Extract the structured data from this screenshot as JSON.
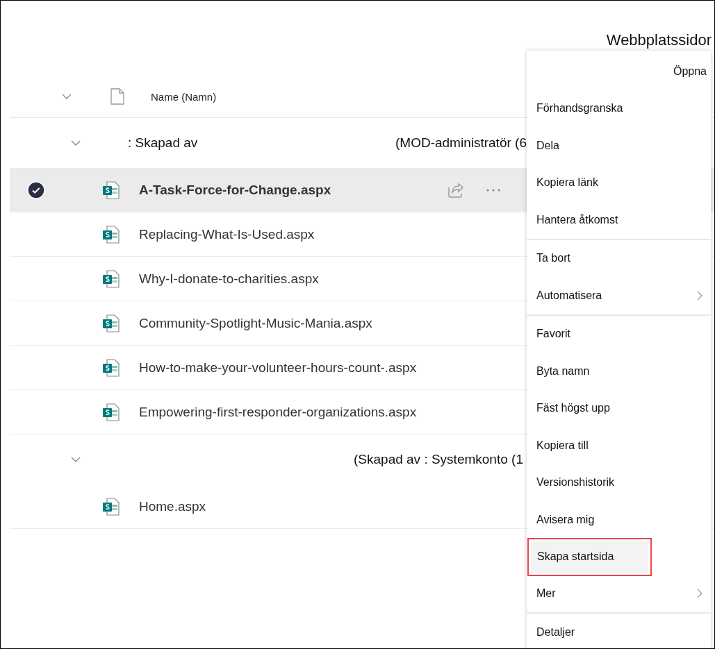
{
  "page_title": "Webbplatssidor",
  "list": {
    "column_header": "Name (Namn)",
    "groups": [
      {
        "title": ": Skapad av",
        "owner": "(MOD-administratör (6",
        "expanded": true,
        "files": [
          {
            "name": "A-Task-Force-for-Change.aspx",
            "selected": true
          },
          {
            "name": "Replacing-What-Is-Used.aspx",
            "selected": false
          },
          {
            "name": "Why-I-donate-to-charities.aspx",
            "selected": false
          },
          {
            "name": "Community-Spotlight-Music-Mania.aspx",
            "selected": false
          },
          {
            "name": "How-to-make-your-volunteer-hours-count-.aspx",
            "selected": false
          },
          {
            "name": "Empowering-first-responder-organizations.aspx",
            "selected": false
          }
        ]
      },
      {
        "owner": "(Skapad av : Systemkonto (1",
        "expanded": true,
        "files": [
          {
            "name": "Home.aspx",
            "selected": false
          }
        ]
      }
    ]
  },
  "menu": {
    "sections": [
      [
        {
          "label": "Öppna",
          "kind": "open",
          "highlighted": false
        },
        {
          "label": "Förhandsgranska",
          "kind": "action",
          "highlighted": false
        },
        {
          "label": "Dela",
          "kind": "action",
          "highlighted": false
        },
        {
          "label": "Kopiera länk",
          "kind": "action",
          "highlighted": false
        },
        {
          "label": "Hantera åtkomst",
          "kind": "action",
          "highlighted": false
        }
      ],
      [
        {
          "label": "Ta bort",
          "kind": "action",
          "highlighted": false
        },
        {
          "label": "Automatisera",
          "kind": "submenu",
          "highlighted": false
        }
      ],
      [
        {
          "label": "Favorit",
          "kind": "action",
          "highlighted": false
        },
        {
          "label": "Byta namn",
          "kind": "action",
          "highlighted": false
        },
        {
          "label": "Fäst högst upp",
          "kind": "action",
          "highlighted": false
        },
        {
          "label": "Kopiera till",
          "kind": "action",
          "highlighted": false
        },
        {
          "label": "Versionshistorik",
          "kind": "action",
          "highlighted": false
        },
        {
          "label": "Avisera mig",
          "kind": "action",
          "highlighted": false
        },
        {
          "label": "Skapa startsida",
          "kind": "action",
          "highlighted": true
        },
        {
          "label": "Mer",
          "kind": "submenu",
          "highlighted": false
        }
      ],
      [
        {
          "label": "Detaljer",
          "kind": "action",
          "highlighted": false
        }
      ]
    ]
  }
}
